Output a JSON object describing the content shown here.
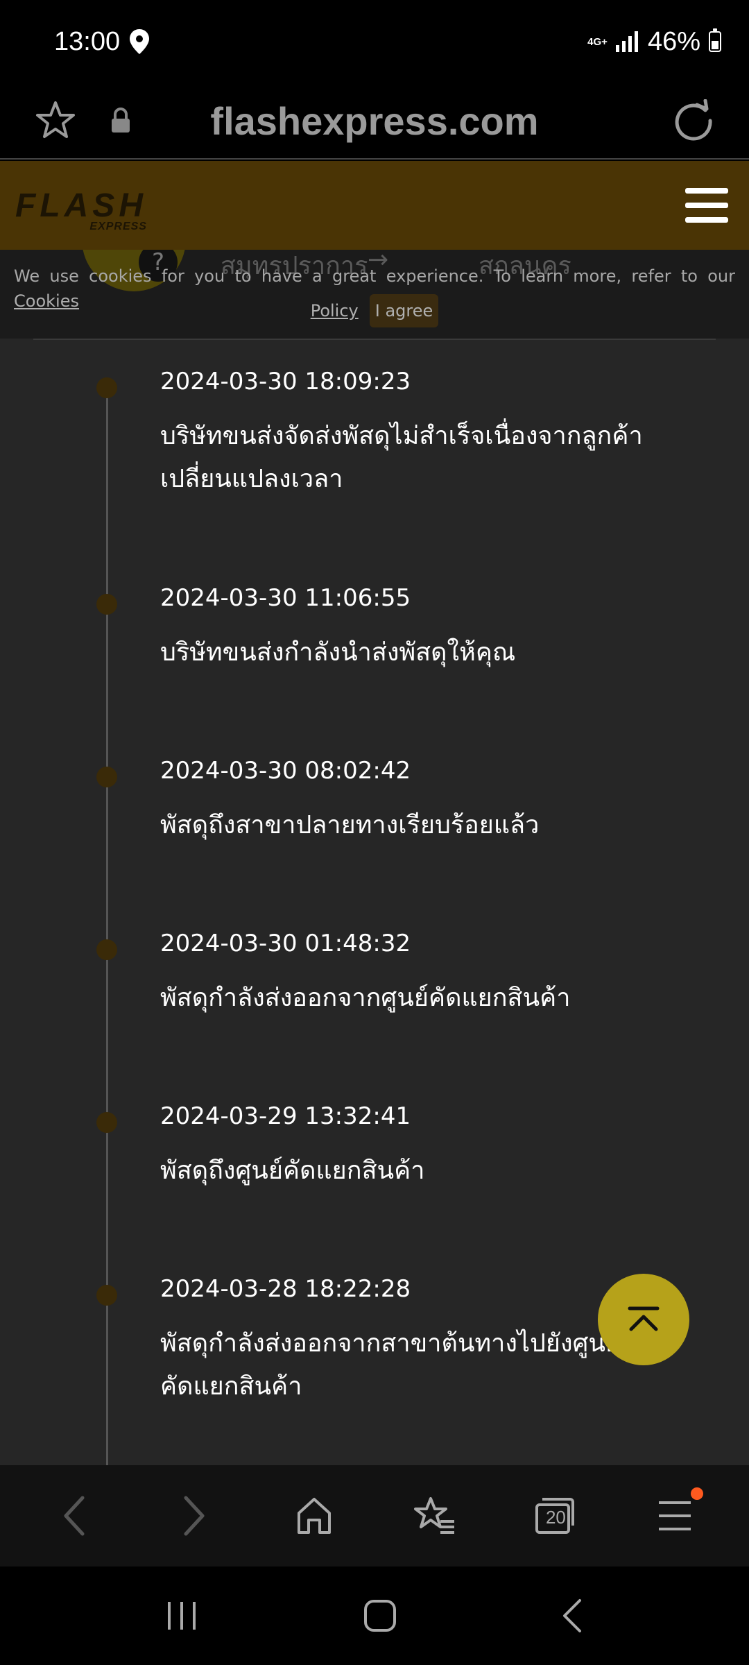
{
  "status_bar": {
    "time": "13:00",
    "network": "4G+",
    "battery": "46%"
  },
  "browser": {
    "url": "flashexpress.com"
  },
  "site": {
    "logo_text": "FLASH",
    "logo_sub": "EXPRESS"
  },
  "route": {
    "from": "สมุทรปราการ",
    "arrow": "→",
    "to": "สกลนคร"
  },
  "cookie_banner": {
    "text_before": "We use cookies for you to have a great experience. To learn more, refer to our",
    "link_1": "Cookies",
    "link_2": "Policy",
    "agree_label": "I agree"
  },
  "timeline": [
    {
      "time": "2024-03-30  18:09:23",
      "description": "บริษัทขนส่งจัดส่งพัสดุไม่สำเร็จเนื่องจากลูกค้าเปลี่ยนแปลงเวลา"
    },
    {
      "time": "2024-03-30  11:06:55",
      "description": "บริษัทขนส่งกำลังนำส่งพัสดุให้คุณ"
    },
    {
      "time": "2024-03-30  08:02:42",
      "description": "พัสดุถึงสาขาปลายทางเรียบร้อยแล้ว"
    },
    {
      "time": "2024-03-30  01:48:32",
      "description": "พัสดุกำลังส่งออกจากศูนย์คัดแยกสินค้า"
    },
    {
      "time": "2024-03-29  13:32:41",
      "description": "พัสดุถึงศูนย์คัดแยกสินค้า"
    },
    {
      "time": "2024-03-28  18:22:28",
      "description": "พัสดุกำลังส่งออกจากสาขาต้นทางไปยังศูนย์คัดแยกสินค้า"
    }
  ],
  "browser_nav": {
    "tabs_count": "20"
  },
  "colors": {
    "header_bg": "#4a3405",
    "content_bg": "#262626",
    "scroll_button": "#b6a21a",
    "notification_dot": "#ff5a1f"
  }
}
